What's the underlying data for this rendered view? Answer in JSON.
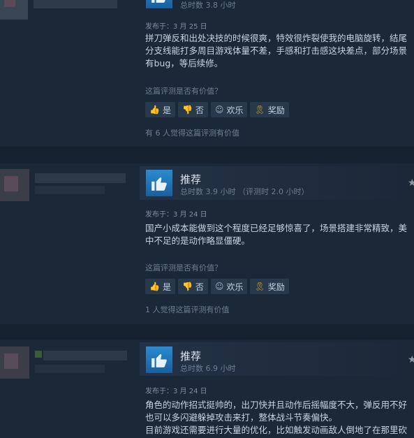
{
  "buttons": {
    "yes": "是",
    "no": "否",
    "funny": "欢乐",
    "award": "奖励"
  },
  "helpful_question": "这篇评测是否有价值？",
  "reviews": [
    {
      "hours": "总时数 3.8 小时",
      "posted": "发布于：3 月 25 日",
      "lines": [
        "拼刀弹反和出处决技的时候很爽，特效很炸裂使我的电脑旋转，结尾",
        "分支线能打多周目游戏体量不差，手感和打击感这块差点，部分场景",
        "有bug，等后续修。"
      ],
      "helpful": "有 6 人觉得这篇评测有价值"
    },
    {
      "verdict": "推荐",
      "hours": "总时数 3.9 小时  （评测时 2.0 小时）",
      "posted": "发布于：3 月 24 日",
      "lines": [
        "国产小成本能做到这个程度已经足够惊喜了，场景搭建非常精致，美",
        "中不足的是动作略显僵硬。"
      ],
      "helpful": "1 人觉得这篇评测有价值"
    },
    {
      "verdict": "推荐",
      "hours": "总时数 6.9 小时",
      "posted": "发布于：3 月 24 日",
      "lines": [
        "角色的动作招式挺帅的，出刀快并且动作后摇幅度不大，弹反用不好",
        "也可以多闪避躲掉攻击来打，整体战斗节奏偏快。",
        "目前游戏还需要进行大量的优化，比如触发动画敌人倒地了在那里砍"
      ]
    }
  ],
  "colors": {
    "background": "#1b2838",
    "accent_thumb": "#2a8bd0"
  }
}
